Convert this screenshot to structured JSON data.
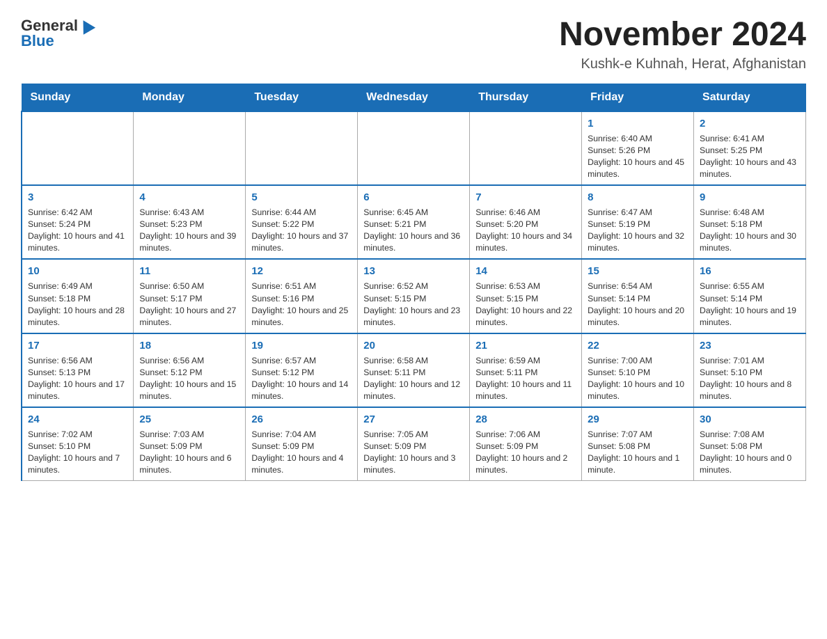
{
  "logo": {
    "general": "General",
    "blue": "Blue"
  },
  "title": "November 2024",
  "subtitle": "Kushk-e Kuhnah, Herat, Afghanistan",
  "days_of_week": [
    "Sunday",
    "Monday",
    "Tuesday",
    "Wednesday",
    "Thursday",
    "Friday",
    "Saturday"
  ],
  "weeks": [
    [
      {
        "day": "",
        "info": ""
      },
      {
        "day": "",
        "info": ""
      },
      {
        "day": "",
        "info": ""
      },
      {
        "day": "",
        "info": ""
      },
      {
        "day": "",
        "info": ""
      },
      {
        "day": "1",
        "info": "Sunrise: 6:40 AM\nSunset: 5:26 PM\nDaylight: 10 hours and 45 minutes."
      },
      {
        "day": "2",
        "info": "Sunrise: 6:41 AM\nSunset: 5:25 PM\nDaylight: 10 hours and 43 minutes."
      }
    ],
    [
      {
        "day": "3",
        "info": "Sunrise: 6:42 AM\nSunset: 5:24 PM\nDaylight: 10 hours and 41 minutes."
      },
      {
        "day": "4",
        "info": "Sunrise: 6:43 AM\nSunset: 5:23 PM\nDaylight: 10 hours and 39 minutes."
      },
      {
        "day": "5",
        "info": "Sunrise: 6:44 AM\nSunset: 5:22 PM\nDaylight: 10 hours and 37 minutes."
      },
      {
        "day": "6",
        "info": "Sunrise: 6:45 AM\nSunset: 5:21 PM\nDaylight: 10 hours and 36 minutes."
      },
      {
        "day": "7",
        "info": "Sunrise: 6:46 AM\nSunset: 5:20 PM\nDaylight: 10 hours and 34 minutes."
      },
      {
        "day": "8",
        "info": "Sunrise: 6:47 AM\nSunset: 5:19 PM\nDaylight: 10 hours and 32 minutes."
      },
      {
        "day": "9",
        "info": "Sunrise: 6:48 AM\nSunset: 5:18 PM\nDaylight: 10 hours and 30 minutes."
      }
    ],
    [
      {
        "day": "10",
        "info": "Sunrise: 6:49 AM\nSunset: 5:18 PM\nDaylight: 10 hours and 28 minutes."
      },
      {
        "day": "11",
        "info": "Sunrise: 6:50 AM\nSunset: 5:17 PM\nDaylight: 10 hours and 27 minutes."
      },
      {
        "day": "12",
        "info": "Sunrise: 6:51 AM\nSunset: 5:16 PM\nDaylight: 10 hours and 25 minutes."
      },
      {
        "day": "13",
        "info": "Sunrise: 6:52 AM\nSunset: 5:15 PM\nDaylight: 10 hours and 23 minutes."
      },
      {
        "day": "14",
        "info": "Sunrise: 6:53 AM\nSunset: 5:15 PM\nDaylight: 10 hours and 22 minutes."
      },
      {
        "day": "15",
        "info": "Sunrise: 6:54 AM\nSunset: 5:14 PM\nDaylight: 10 hours and 20 minutes."
      },
      {
        "day": "16",
        "info": "Sunrise: 6:55 AM\nSunset: 5:14 PM\nDaylight: 10 hours and 19 minutes."
      }
    ],
    [
      {
        "day": "17",
        "info": "Sunrise: 6:56 AM\nSunset: 5:13 PM\nDaylight: 10 hours and 17 minutes."
      },
      {
        "day": "18",
        "info": "Sunrise: 6:56 AM\nSunset: 5:12 PM\nDaylight: 10 hours and 15 minutes."
      },
      {
        "day": "19",
        "info": "Sunrise: 6:57 AM\nSunset: 5:12 PM\nDaylight: 10 hours and 14 minutes."
      },
      {
        "day": "20",
        "info": "Sunrise: 6:58 AM\nSunset: 5:11 PM\nDaylight: 10 hours and 12 minutes."
      },
      {
        "day": "21",
        "info": "Sunrise: 6:59 AM\nSunset: 5:11 PM\nDaylight: 10 hours and 11 minutes."
      },
      {
        "day": "22",
        "info": "Sunrise: 7:00 AM\nSunset: 5:10 PM\nDaylight: 10 hours and 10 minutes."
      },
      {
        "day": "23",
        "info": "Sunrise: 7:01 AM\nSunset: 5:10 PM\nDaylight: 10 hours and 8 minutes."
      }
    ],
    [
      {
        "day": "24",
        "info": "Sunrise: 7:02 AM\nSunset: 5:10 PM\nDaylight: 10 hours and 7 minutes."
      },
      {
        "day": "25",
        "info": "Sunrise: 7:03 AM\nSunset: 5:09 PM\nDaylight: 10 hours and 6 minutes."
      },
      {
        "day": "26",
        "info": "Sunrise: 7:04 AM\nSunset: 5:09 PM\nDaylight: 10 hours and 4 minutes."
      },
      {
        "day": "27",
        "info": "Sunrise: 7:05 AM\nSunset: 5:09 PM\nDaylight: 10 hours and 3 minutes."
      },
      {
        "day": "28",
        "info": "Sunrise: 7:06 AM\nSunset: 5:09 PM\nDaylight: 10 hours and 2 minutes."
      },
      {
        "day": "29",
        "info": "Sunrise: 7:07 AM\nSunset: 5:08 PM\nDaylight: 10 hours and 1 minute."
      },
      {
        "day": "30",
        "info": "Sunrise: 7:08 AM\nSunset: 5:08 PM\nDaylight: 10 hours and 0 minutes."
      }
    ]
  ]
}
